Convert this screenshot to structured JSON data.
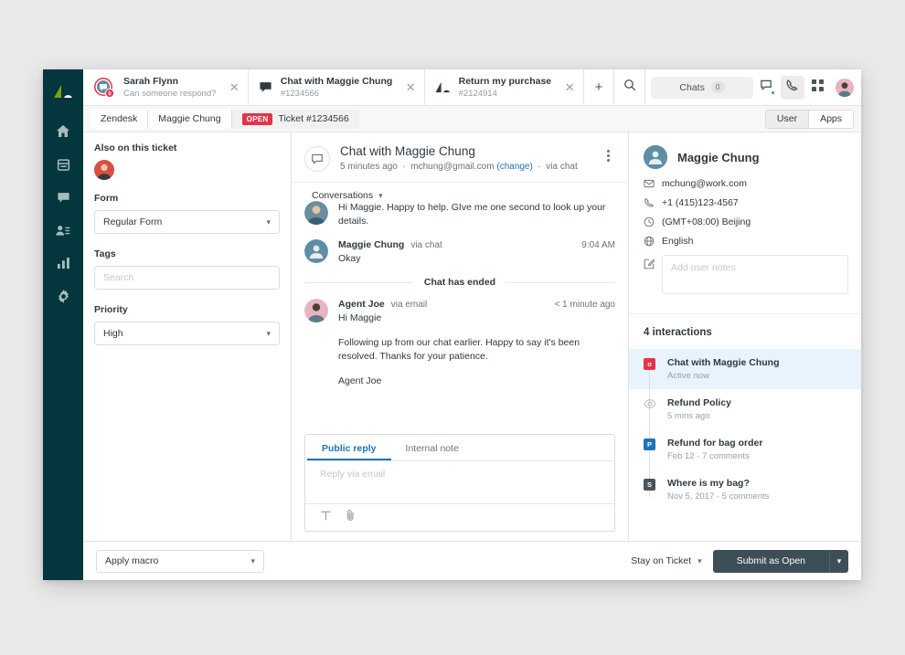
{
  "nav_rail": {
    "items": [
      {
        "name": "zendesk-logo",
        "label": "Zendesk"
      },
      {
        "name": "home",
        "label": "Home"
      },
      {
        "name": "views",
        "label": "Views"
      },
      {
        "name": "chat",
        "label": "Chat"
      },
      {
        "name": "customers",
        "label": "Customers"
      },
      {
        "name": "reporting",
        "label": "Reporting"
      },
      {
        "name": "settings",
        "label": "Settings"
      }
    ],
    "background": "#03363D"
  },
  "tabs": [
    {
      "title": "Sarah Flynn",
      "subtitle": "Can someone respond?",
      "icon": "chat-avatar-icon",
      "badge": "0",
      "active": false
    },
    {
      "title": "Chat with Maggie Chung",
      "subtitle": "#1234566",
      "icon": "chat-bubble-icon",
      "active": true
    },
    {
      "title": "Return my purchase",
      "subtitle": "#2124914",
      "icon": "zendesk-mark-icon",
      "active": false
    }
  ],
  "tab_tools": {
    "add_label": "+",
    "search_label": "search-icon",
    "chats_label": "Chats",
    "chats_count": "0"
  },
  "breadcrumb": {
    "items": [
      "Zendesk",
      "Maggie Chung"
    ],
    "status": "OPEN",
    "ticket": "Ticket #1234566"
  },
  "view_toggle": {
    "options": [
      "User",
      "Apps"
    ],
    "selected": "Apps"
  },
  "left_panel": {
    "also_on_ticket_label": "Also on this ticket",
    "form_label": "Form",
    "form_value": "Regular Form",
    "tags_label": "Tags",
    "tags_placeholder": "Search",
    "priority_label": "Priority",
    "priority_value": "High"
  },
  "conversation": {
    "title": "Chat with Maggie Chung",
    "time": "5 minutes ago",
    "email": "mchung@gmail.com",
    "change_link": "(change)",
    "channel": "via chat",
    "filter_label": "Conversations",
    "messages": [
      {
        "author": "",
        "via": "",
        "time": "",
        "lines": [
          "Hi Maggie. Happy to help. GIve me one second to look up your details."
        ],
        "avatar_color": "#6a8ea0",
        "partial": true
      },
      {
        "author": "Maggie Chung",
        "via": "via chat",
        "time": "9:04 AM",
        "lines": [
          "Okay"
        ],
        "avatar_color": "#5f8da6",
        "partial": false
      }
    ],
    "divider": "Chat has ended",
    "last_message": {
      "author": "Agent Joe",
      "via": "via email",
      "time": "< 1 minute ago",
      "lines": [
        "Hi Maggie",
        "Following up from our chat earlier. Happy to say it's been resolved. Thanks for your patience.",
        "Agent Joe"
      ],
      "avatar_color": "#e8b4c0"
    }
  },
  "composer": {
    "tabs": [
      {
        "label": "Public reply",
        "active": true
      },
      {
        "label": "Internal note",
        "active": false
      }
    ],
    "placeholder": "Reply via email",
    "tools": [
      "T",
      "\u0001f4ce"
    ]
  },
  "user_panel": {
    "name": "Maggie Chung",
    "rows": [
      {
        "icon": "mail-icon",
        "value": "mchung@work.com"
      },
      {
        "icon": "phone-icon",
        "value": "+1 (415)123-4567"
      },
      {
        "icon": "clock-icon",
        "value": "(GMT+08:00) Beijing"
      },
      {
        "icon": "globe-icon",
        "value": "English"
      }
    ],
    "notes_icon": "note-edit-icon",
    "notes_placeholder": "Add user notes",
    "interactions_title": "4 interactions",
    "interactions": [
      {
        "title": "Chat with Maggie Chung",
        "meta": "Active now",
        "badge": "o",
        "badge_color": "#e4344a",
        "icon_type": "square",
        "selected": true
      },
      {
        "title": "Refund Policy",
        "meta": "5 mins ago",
        "badge": "",
        "badge_color": "",
        "icon_type": "eye",
        "selected": false
      },
      {
        "title": "Refund for bag order",
        "meta": "Feb 12 · 7 comments",
        "badge": "P",
        "badge_color": "#1f73b7",
        "icon_type": "square",
        "selected": false
      },
      {
        "title": "Where is my bag?",
        "meta": "Nov 5, 2017 · 5 comments",
        "badge": "S",
        "badge_color": "#49545c",
        "icon_type": "square",
        "selected": false
      }
    ]
  },
  "footer": {
    "macro_value": "Apply macro",
    "stay_value": "Stay on Ticket",
    "submit_label": "Submit as Open"
  },
  "colors": {
    "nav_bg": "#03363D",
    "accent_blue": "#1f73b7",
    "status_red": "#e4344a",
    "submit_dark": "#3e4e57",
    "selected_row": "#e8f3fb"
  }
}
